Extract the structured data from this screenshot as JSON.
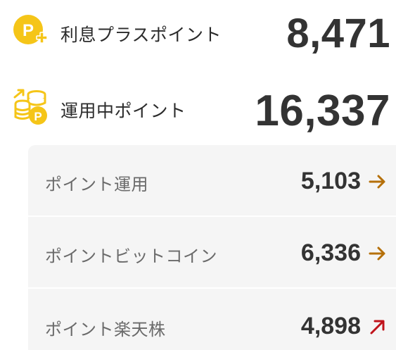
{
  "summary": {
    "interest_plus": {
      "label": "利息プラスポイント",
      "value": "8,471",
      "icon": "coin-p-plus-icon"
    },
    "in_operation": {
      "label": "運用中ポイント",
      "value": "16,337",
      "icon": "coin-stack-p-icon"
    }
  },
  "breakdown": [
    {
      "label": "ポイント運用",
      "value": "5,103",
      "arrow": "right-arrow-icon",
      "arrow_color": "#b5700a"
    },
    {
      "label": "ポイントビットコイン",
      "value": "6,336",
      "arrow": "right-arrow-icon",
      "arrow_color": "#b5700a"
    },
    {
      "label": "ポイント楽天株",
      "value": "4,898",
      "arrow": "up-right-arrow-icon",
      "arrow_color": "#c0131b"
    }
  ],
  "colors": {
    "coin_yellow": "#f5c518",
    "panel_bg": "#f5f5f5"
  }
}
